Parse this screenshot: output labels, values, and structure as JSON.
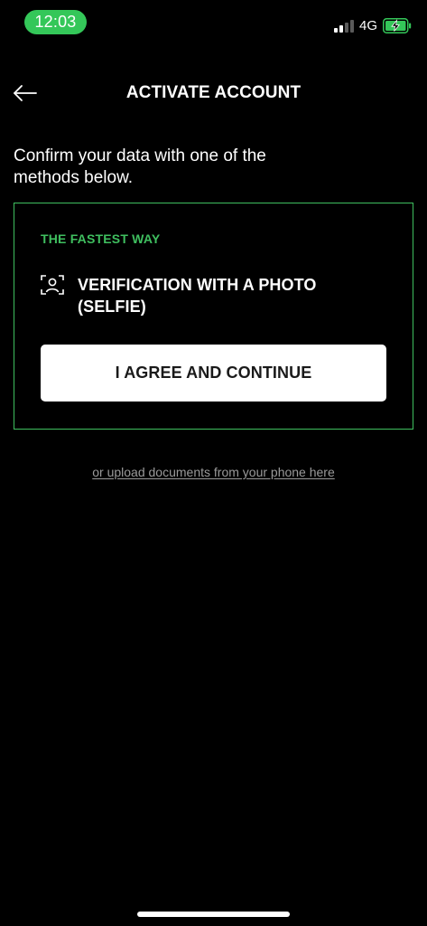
{
  "status_bar": {
    "time": "12:03",
    "network": "4G",
    "time_pill_color": "#34c759",
    "battery_charging_color": "#34c759"
  },
  "header": {
    "title": "ACTIVATE ACCOUNT",
    "back_icon": "arrow-left-icon"
  },
  "intro_text": "Confirm your data with one of the methods below.",
  "card": {
    "label": "THE FASTEST WAY",
    "method_icon": "face-scan-icon",
    "method_title": "VERIFICATION WITH A PHOTO (SELFIE)",
    "button_label": "I AGREE AND CONTINUE",
    "accent_color": "#3fbf5f"
  },
  "upload_link": "or upload documents from your phone here"
}
